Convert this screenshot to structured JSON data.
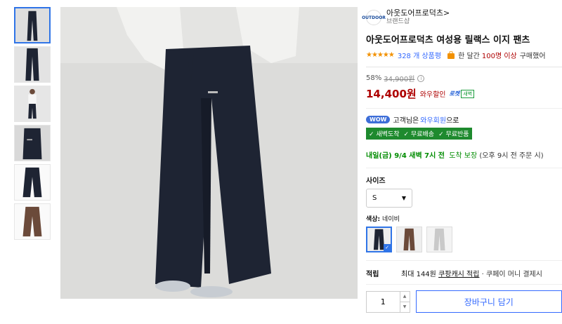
{
  "brand": {
    "logo_text": "OUTDOOR",
    "name": "아웃도어프로덕츠",
    "chevron": ">",
    "subtitle": "브랜드샵"
  },
  "product": {
    "title": "아웃도어프로덕츠 여성용 릴랙스 이지 팬츠"
  },
  "rating": {
    "stars": "★★★★★",
    "review_count": "328 개 상품평",
    "buy_text": "한 달간",
    "buy_count": "100명 이상",
    "buy_suffix": "구매했어"
  },
  "price": {
    "discount_rate": "58%",
    "original": "34,900원",
    "info_icon": "i",
    "sale": "14,400원",
    "sale_label": "와우할인",
    "rocket_label": "로켓",
    "dawn_badge": "새벽"
  },
  "wow": {
    "badge": "WOW",
    "text": "고객님은",
    "link": "와우회원",
    "suffix": "으로",
    "benefits": [
      "✓ 새벽도착",
      "✓ 무료배송",
      "✓ 무료반품"
    ]
  },
  "delivery": {
    "date": "내일(금) 9/4 새벽 7시 전",
    "label": "도착 보장",
    "condition": "(오후 9시 전 주문 시)"
  },
  "size": {
    "label": "사이즈",
    "selected": "S",
    "caret": "▼"
  },
  "color": {
    "label": "색상:",
    "selected": "네이비",
    "check": "✓"
  },
  "reward": {
    "label": "적립",
    "prefix": "최대 144원",
    "link": "쿠팡캐시 적립",
    "rest": "· 쿠페이 머니 결제시"
  },
  "purchase": {
    "quantity": "1",
    "up": "▲",
    "down": "▼",
    "cart_label": "장바구니 담기"
  },
  "colors": {
    "accent": "#346aff",
    "price": "#ae0000",
    "green": "#1e8a2e",
    "navy": "#1e2433",
    "brown": "#6b4a3a",
    "gray": "#c9c9c9"
  }
}
